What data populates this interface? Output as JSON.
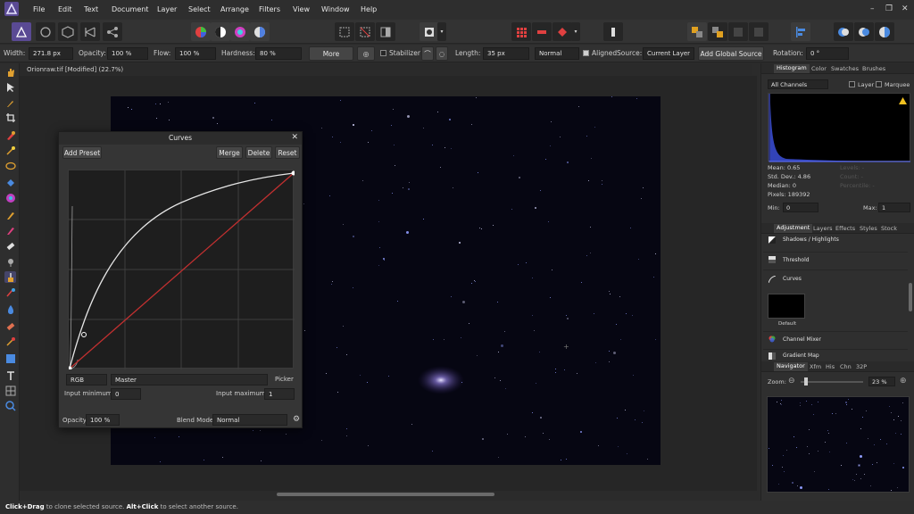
{
  "menu": [
    "File",
    "Edit",
    "Text",
    "Document",
    "Layer",
    "Select",
    "Arrange",
    "Filters",
    "View",
    "Window",
    "Help"
  ],
  "context_bar": {
    "width_label": "Width:",
    "width_value": "271.8 px",
    "opacity_label": "Opacity:",
    "opacity_value": "100 %",
    "flow_label": "Flow:",
    "flow_value": "100 %",
    "hardness_label": "Hardness:",
    "hardness_value": "80 %",
    "more_button": "More",
    "stabilizer_label": "Stabilizer",
    "length_label": "Length:",
    "length_value": "35 px",
    "blend_value": "Normal",
    "aligned_label": "Aligned",
    "source_label": "Source:",
    "source_value": "Current Layer",
    "add_global_source": "Add Global Source",
    "rotation_label": "Rotation:",
    "rotation_value": "0 °"
  },
  "document_tab": "Orionraw.tif [Modified] (22.7%)",
  "curves_dialog": {
    "title": "Curves",
    "add_preset": "Add Preset",
    "merge": "Merge",
    "delete": "Delete",
    "reset": "Reset",
    "channel_value": "RGB",
    "master_value": "Master",
    "picker": "Picker",
    "input_min_label": "Input minimum:",
    "input_min_value": "0",
    "input_max_label": "Input maximum:",
    "input_max_value": "1",
    "opacity_label": "Opacity:",
    "opacity_value": "100 %",
    "blend_label": "Blend Mode:",
    "blend_value": "Normal"
  },
  "histogram_panel": {
    "tabs": [
      "Histogram",
      "Color",
      "Swatches",
      "Brushes"
    ],
    "channels_value": "All Channels",
    "layer_label": "Layer",
    "marquee_label": "Marquee",
    "mean": "Mean: 0.65",
    "std_dev": "Std. Dev.: 4.86",
    "median": "Median: 0",
    "pixels": "Pixels: 189392",
    "levels": "Levels: -",
    "count": "Count: -",
    "percentile": "Percentile: -",
    "min_label": "Min:",
    "min_value": "0",
    "max_label": "Max:",
    "max_value": "1",
    "warning_icon": "warning-icon"
  },
  "adjustment_panel": {
    "tabs": [
      "Adjustment",
      "Layers",
      "Effects",
      "Styles",
      "Stock"
    ],
    "items": [
      "Shadows / Highlights",
      "Threshold",
      "Curves",
      "Channel Mixer",
      "Gradient Map"
    ],
    "preset_label": "Default"
  },
  "navigator_panel": {
    "tabs": [
      "Navigator",
      "Xfm",
      "His",
      "Chn",
      "32P"
    ],
    "zoom_label": "Zoom:",
    "zoom_value": "23 %"
  },
  "status": {
    "key1": "Click+Drag",
    "text1": " to clone selected source. ",
    "key2": "Alt+Click",
    "text2": " to select another source."
  },
  "colors": {
    "accent": "#4a6ea8",
    "curve_white": "#e6e6e6",
    "curve_red": "#c23030",
    "histogram_blue": "#3b4fd8"
  }
}
